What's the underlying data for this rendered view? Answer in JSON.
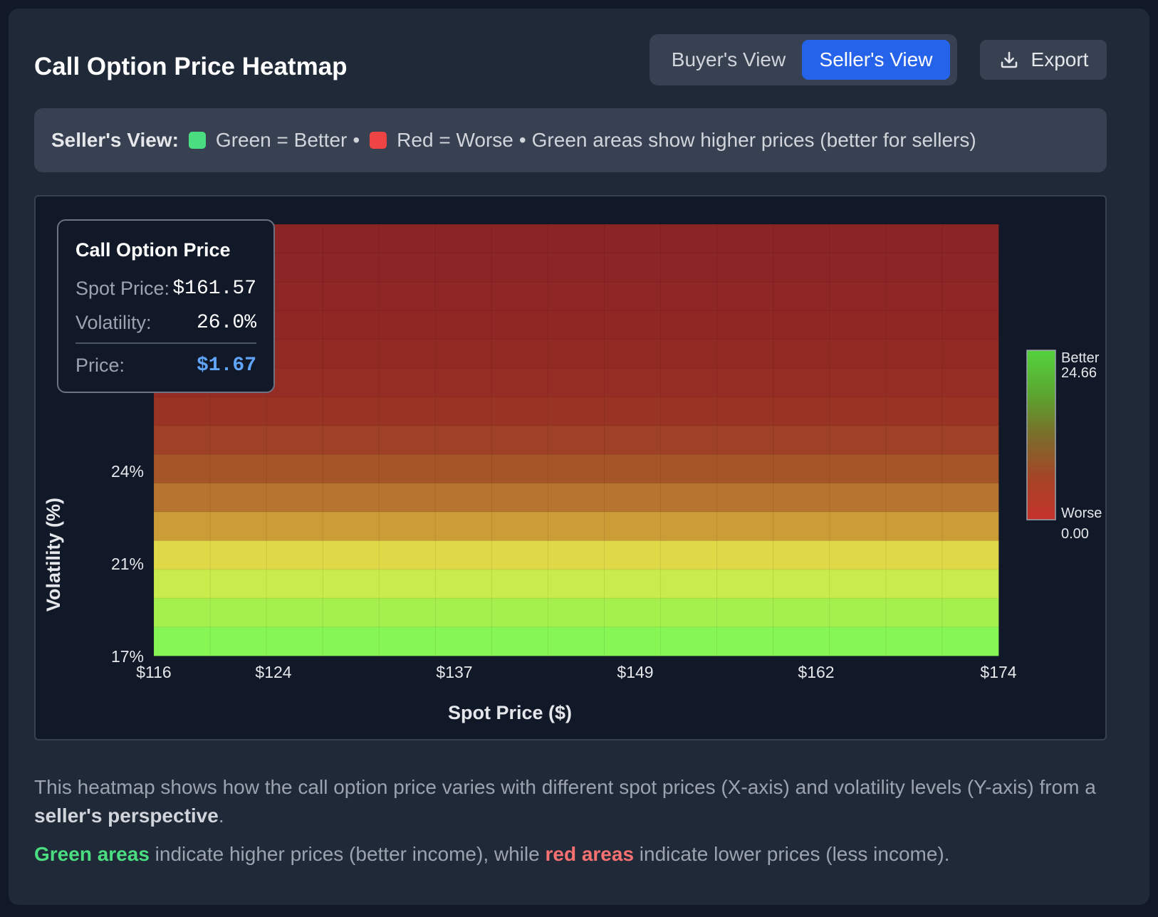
{
  "title": "Call Option Price Heatmap",
  "view_toggle": {
    "buyer_label": "Buyer's View",
    "seller_label": "Seller's View",
    "active": "seller"
  },
  "export_label": "Export",
  "legend": {
    "label": "Seller's View:",
    "green_text": "Green = Better",
    "red_text": "Red = Worse",
    "bullet": "•",
    "note": "Green areas show higher prices (better for sellers)"
  },
  "tooltip": {
    "title": "Call Option Price",
    "spot_label": "Spot Price:",
    "spot_value": "$161.57",
    "vol_label": "Volatility:",
    "vol_value": "26.0%",
    "price_label": "Price:",
    "price_value": "$1.67"
  },
  "description": {
    "p1_text": "This heatmap shows how the call option price varies with different spot prices (X-axis) and volatility levels (Y-axis) from a ",
    "p1_bold": "seller's perspective",
    "p1_end": ".",
    "p2_green": "Green areas",
    "p2_mid": " indicate higher prices (better income), while ",
    "p2_red": "red areas",
    "p2_end": " indicate lower prices (less income)."
  },
  "chart_data": {
    "type": "heatmap",
    "xlabel": "Spot Price ($)",
    "ylabel": "Volatility (%)",
    "x_ticks": [
      "$116",
      "$124",
      "$137",
      "$149",
      "$162",
      "$174"
    ],
    "y_ticks": [
      "24%",
      "21%",
      "17%"
    ],
    "columns": 15,
    "rows": 15,
    "row_colors_top_to_bottom": [
      "#8b2424",
      "#8c2525",
      "#8e2626",
      "#902724",
      "#922a24",
      "#952d24",
      "#993424",
      "#9f4126",
      "#a65528",
      "#b77430",
      "#cc9c36",
      "#dfd847",
      "#c8ec4b",
      "#a6f04e",
      "#86f654"
    ],
    "legend_top_label": "Better",
    "legend_top_value": "24.66",
    "legend_bottom_label": "Worse",
    "legend_bottom_value": "0.00",
    "legend_colors": [
      "#54d23d",
      "#5aa830",
      "#7a6e2a",
      "#a54426",
      "#c4322a"
    ]
  }
}
